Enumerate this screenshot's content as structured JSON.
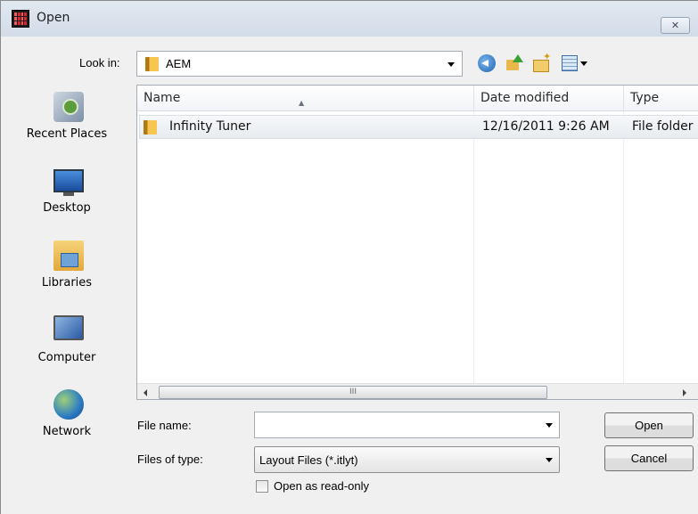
{
  "window": {
    "title": "Open",
    "close_glyph": "✕"
  },
  "lookin": {
    "label": "Look in:",
    "value": "AEM"
  },
  "toolbar": {
    "icons": [
      "back-icon",
      "up-folder-icon",
      "new-folder-icon",
      "views-menu-icon"
    ]
  },
  "places": [
    {
      "label": "Recent Places",
      "icon": "recent-places-icon"
    },
    {
      "label": "Desktop",
      "icon": "desktop-icon"
    },
    {
      "label": "Libraries",
      "icon": "libraries-icon"
    },
    {
      "label": "Computer",
      "icon": "computer-icon"
    },
    {
      "label": "Network",
      "icon": "network-icon"
    }
  ],
  "filelist": {
    "columns": [
      "Name",
      "Date modified",
      "Type"
    ],
    "rows": [
      {
        "name": "Infinity Tuner",
        "date": "12/16/2011 9:26 AM",
        "type": "File folder"
      }
    ],
    "scroll_grip": "III"
  },
  "filename": {
    "label": "File name:",
    "value": ""
  },
  "filetype": {
    "label": "Files of type:",
    "value": "Layout Files (*.itlyt)"
  },
  "buttons": {
    "open": "Open",
    "cancel": "Cancel"
  },
  "readonly": {
    "label": "Open as read-only",
    "checked": false
  }
}
